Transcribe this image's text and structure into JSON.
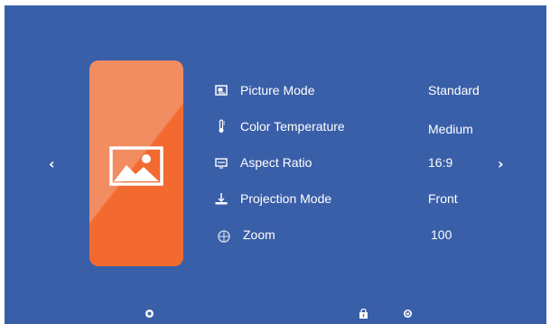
{
  "navigation": {
    "prev_glyph": "‹",
    "next_glyph": "›"
  },
  "card": {
    "icon": "picture-icon",
    "colors": {
      "light": "#f28c61",
      "dark": "#f26a2f"
    }
  },
  "menu": {
    "items": [
      {
        "label": "Picture Mode",
        "value": "Standard",
        "icon": "picture-mode-icon"
      },
      {
        "label": "Color Temperature",
        "value": "Medium",
        "icon": "thermometer-icon"
      },
      {
        "label": "Aspect Ratio",
        "value": "16:9",
        "icon": "aspect-ratio-icon"
      },
      {
        "label": "Projection Mode",
        "value": "Front",
        "icon": "projector-icon"
      },
      {
        "label": "Zoom",
        "value": "100",
        "icon": "zoom-icon"
      }
    ]
  },
  "footer": {
    "icons": [
      "settings-icon",
      "lock-icon",
      "power-icon"
    ]
  },
  "colors": {
    "background": "#3a5fa9",
    "text": "#ffffff"
  }
}
